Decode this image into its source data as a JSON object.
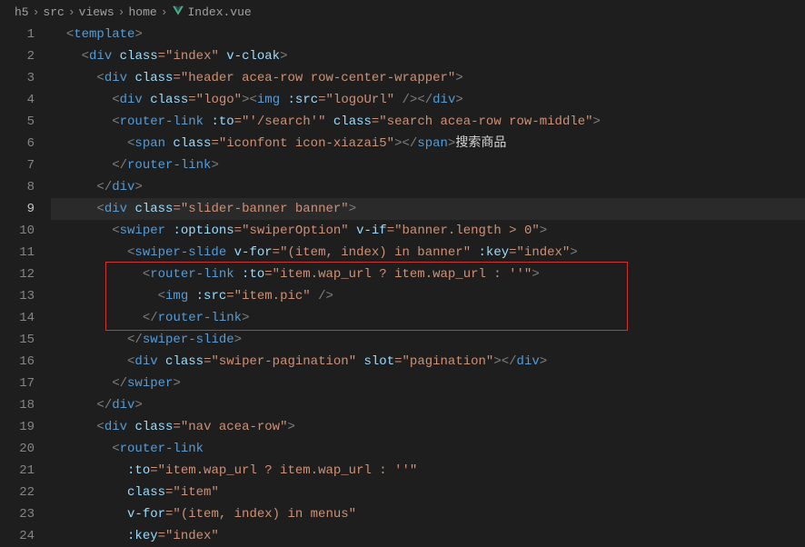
{
  "breadcrumb": {
    "items": [
      "h5",
      "src",
      "views",
      "home",
      "Index.vue"
    ]
  },
  "lines": {
    "count": 24,
    "active": 9
  },
  "code": {
    "l1": {
      "indent": "  ",
      "open": "<",
      "tag": "template",
      "close": ">"
    },
    "l2": {
      "indent": "    ",
      "open": "<",
      "tag": "div",
      "a1n": " class",
      "a1v": "=\"index\"",
      "a2n": " v-cloak",
      "close": ">"
    },
    "l3": {
      "indent": "      ",
      "open": "<",
      "tag": "div",
      "a1n": " class",
      "a1v": "=\"header acea-row row-center-wrapper\"",
      "close": ">"
    },
    "l4": {
      "indent": "        ",
      "open": "<",
      "tag": "div",
      "a1n": " class",
      "a1v": "=\"logo\"",
      "mid": "><",
      "tag2": "img",
      "a2n": " :src",
      "a2v": "=\"logoUrl\"",
      "mid2": " /></",
      "tag3": "div",
      "close": ">"
    },
    "l5": {
      "indent": "        ",
      "open": "<",
      "tag": "router-link",
      "a1n": " :to",
      "a1v": "=\"'/search'\"",
      "a2n": " class",
      "a2v": "=\"search acea-row row-middle\"",
      "close": ">"
    },
    "l6": {
      "indent": "          ",
      "open": "<",
      "tag": "span",
      "a1n": " class",
      "a1v": "=\"iconfont icon-xiazai5\"",
      "mid": "></",
      "tag2": "span",
      "close": ">",
      "text": "搜索商品"
    },
    "l7": {
      "indent": "        ",
      "open": "</",
      "tag": "router-link",
      "close": ">"
    },
    "l8": {
      "indent": "      ",
      "open": "</",
      "tag": "div",
      "close": ">"
    },
    "l9": {
      "indent": "      ",
      "open": "<",
      "tag": "div",
      "a1n": " class",
      "a1v": "=\"slider-banner banner\"",
      "close": ">"
    },
    "l10": {
      "indent": "        ",
      "open": "<",
      "tag": "swiper",
      "a1n": " :options",
      "a1v": "=\"swiperOption\"",
      "a2n": " v-if",
      "a2v": "=\"banner.length > 0\"",
      "close": ">"
    },
    "l11": {
      "indent": "          ",
      "open": "<",
      "tag": "swiper-slide",
      "a1n": " v-for",
      "a1v": "=\"(item, index) in banner\"",
      "a2n": " :key",
      "a2v": "=\"index\"",
      "close": ">"
    },
    "l12": {
      "indent": "            ",
      "open": "<",
      "tag": "router-link",
      "a1n": " :to",
      "a1v": "=\"item.wap_url ? item.wap_url : ''\"",
      "close": ">"
    },
    "l13": {
      "indent": "              ",
      "open": "<",
      "tag": "img",
      "a1n": " :src",
      "a1v": "=\"item.pic\"",
      "close": " />"
    },
    "l14": {
      "indent": "            ",
      "open": "</",
      "tag": "router-link",
      "close": ">"
    },
    "l15": {
      "indent": "          ",
      "open": "</",
      "tag": "swiper-slide",
      "close": ">"
    },
    "l16": {
      "indent": "          ",
      "open": "<",
      "tag": "div",
      "a1n": " class",
      "a1v": "=\"swiper-pagination\"",
      "a2n": " slot",
      "a2v": "=\"pagination\"",
      "mid": "></",
      "tag2": "div",
      "close": ">"
    },
    "l17": {
      "indent": "        ",
      "open": "</",
      "tag": "swiper",
      "close": ">"
    },
    "l18": {
      "indent": "      ",
      "open": "</",
      "tag": "div",
      "close": ">"
    },
    "l19": {
      "indent": "      ",
      "open": "<",
      "tag": "div",
      "a1n": " class",
      "a1v": "=\"nav acea-row\"",
      "close": ">"
    },
    "l20": {
      "indent": "        ",
      "open": "<",
      "tag": "router-link"
    },
    "l21": {
      "indent": "          ",
      "a1n": ":to",
      "a1v": "=\"item.wap_url ? item.wap_url : ''\""
    },
    "l22": {
      "indent": "          ",
      "a1n": "class",
      "a1v": "=\"item\""
    },
    "l23": {
      "indent": "          ",
      "a1n": "v-for",
      "a1v": "=\"(item, index) in menus\""
    },
    "l24": {
      "indent": "          ",
      "a1n": ":key",
      "a1v": "=\"index\""
    }
  }
}
